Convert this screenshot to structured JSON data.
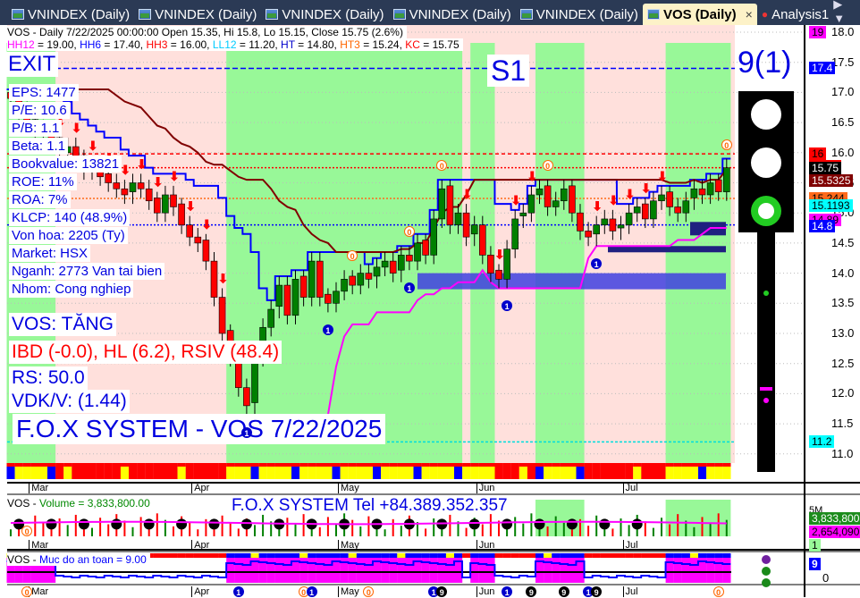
{
  "tabs": [
    {
      "label": "VNINDEX (Daily)"
    },
    {
      "label": "VNINDEX (Daily)"
    },
    {
      "label": "VNINDEX (Daily)"
    },
    {
      "label": "VNINDEX (Daily)"
    },
    {
      "label": "VNINDEX (Daily)"
    },
    {
      "label": "VOS (Daily)",
      "active": true
    },
    {
      "label": "Analysis1"
    }
  ],
  "tab_close": "×",
  "tab_nav": "◀ ▶ ▼",
  "header": {
    "line1": "VOS - Daily 7/22/2025 00:00:00 Open 15.35, Hi 15.8, Lo 15.15, Close 15.75 (2.6%)",
    "hh12": "HH12",
    "hh12v": " = 19.00, ",
    "hh6": "HH6",
    "hh6v": " = 17.40, ",
    "hh3": "HH3",
    "hh3v": " = 16.00, ",
    "ll12": "LL12",
    "ll12v": " = 11.20, ",
    "ht": "HT",
    "htv": "  = 14.80, ",
    "ht3": "HT3",
    "ht3v": "  = 15.24, ",
    "kc": "KC",
    "kcv": " = 15.75"
  },
  "signal_exit": "EXIT",
  "signal_s1": "S1",
  "signal_count": "9(1)",
  "fundamentals": [
    "EPS: 1477",
    "P/E: 10.6",
    "P/B: 1.1",
    "Beta: 1.1",
    "Bookvalue: 13821",
    "ROE: 11%",
    "ROA: 7%",
    "KLCP: 140 (48.9%)",
    "Von hoa: 2205 (Ty)",
    "Market: HSX",
    "Nganh: 2773 Van tai bien",
    "Nhom: Cong nghiep"
  ],
  "status": "VOS: TĂNG",
  "ibd": "IBD (-0.0), HL (6.2), RSIV (48.4)",
  "rs": "RS: 50.0",
  "vdk": "VDK/V:  (1.44)",
  "watermark": "F.O.X SYSTEM - VOS 7/22/2025",
  "price_axis": [
    "18.0",
    "17.5",
    "17.0",
    "16.5",
    "16.0",
    "15.5",
    "15.0",
    "14.5",
    "14.0",
    "13.5",
    "13.0",
    "12.5",
    "12.0",
    "11.5",
    "11.0"
  ],
  "price_badges": [
    {
      "text": "19",
      "bg": "#ff00ff",
      "price": 18.0
    },
    {
      "text": "17.4",
      "bg": "#0000ff",
      "fg": "#fff",
      "price": 17.4
    },
    {
      "text": "16",
      "bg": "#ff0000",
      "price": 15.98
    },
    {
      "text": "15.75",
      "bg": "#ff0000",
      "price": 15.78
    },
    {
      "text": "15.75",
      "bg": "#000",
      "fg": "#fff",
      "price": 15.75
    },
    {
      "text": "15.5325",
      "bg": "#800000",
      "fg": "#fff",
      "price": 15.53
    },
    {
      "text": "15.244",
      "bg": "#ff6a1a",
      "price": 15.24
    },
    {
      "text": "15.1193",
      "bg": "#00ffff",
      "price": 15.12
    },
    {
      "text": "14.89",
      "bg": "#ff00ff",
      "price": 14.89
    },
    {
      "text": "14.8",
      "bg": "#0000ff",
      "fg": "#fff",
      "price": 14.78
    },
    {
      "text": "11.2",
      "bg": "#00ffff",
      "price": 11.2
    }
  ],
  "months": [
    "Mar",
    "Apr",
    "May",
    "Jun",
    "Jul"
  ],
  "volume": {
    "title": "VOS",
    "title2": "Volume = 3,833,800.00",
    "banner": "F.O.X SYSTEM Tel +84.389.352.357",
    "axis_5m": "5M",
    "badge_current": "3,833,800",
    "badge_avg": "2,654,090",
    "badge_one": "1"
  },
  "safety": {
    "title": "VOS",
    "title2": "Muc do an toan = 9.00",
    "badge": "9",
    "axis_zero": "0"
  },
  "colors": {
    "up": "#008000",
    "down": "#ff0000",
    "green_zone": "#98f898",
    "pink_zone": "#ffe0dc",
    "blue_line": "#0000ff",
    "brown_line": "#800000",
    "magenta_line": "#ff00ff"
  },
  "chart_data": {
    "type": "candlestick",
    "symbol": "VOS",
    "interval": "Daily",
    "ylim": [
      10.6,
      18.3
    ],
    "close": [
      16.9,
      16.7,
      16.5,
      16.4,
      16.3,
      16.2,
      16.0,
      16.1,
      15.9,
      15.7,
      15.8,
      15.6,
      15.5,
      15.4,
      15.3,
      15.5,
      15.4,
      15.2,
      15.0,
      15.3,
      15.1,
      14.8,
      14.6,
      14.5,
      14.2,
      13.6,
      13.0,
      12.6,
      12.1,
      11.8,
      12.6,
      13.1,
      13.4,
      13.8,
      13.3,
      13.9,
      13.6,
      14.2,
      13.6,
      13.5,
      13.7,
      13.9,
      13.8,
      14.0,
      13.9,
      14.1,
      14.2,
      14.0,
      14.3,
      14.2,
      14.5,
      14.3,
      14.9,
      15.4,
      14.8,
      15.0,
      14.6,
      14.8,
      14.3,
      14.0,
      13.9,
      14.4,
      14.9,
      15.0,
      15.3,
      15.4,
      15.1,
      15.2,
      15.4,
      15.0,
      14.7,
      14.6,
      14.8,
      14.9,
      14.7,
      14.8,
      15.0,
      15.1,
      14.9,
      15.2,
      15.3,
      15.1,
      15.0,
      15.2,
      15.4,
      15.3,
      15.5,
      15.35,
      15.75
    ],
    "month_start_index": [
      2,
      22,
      40,
      57,
      75
    ],
    "green_zones": [
      [
        0,
        4
      ],
      [
        5,
        5
      ],
      [
        27,
        55
      ],
      [
        57,
        59
      ],
      [
        65,
        70
      ],
      [
        81,
        88
      ]
    ],
    "last": {
      "open": 15.35,
      "high": 15.8,
      "low": 15.15,
      "close": 15.75,
      "change_pct": 2.6
    },
    "levels": {
      "HH6": 17.4,
      "HH3": 16.0,
      "KC": 15.75,
      "HT3": 15.24,
      "HT": 14.8,
      "LL12": 11.2
    },
    "signals": [
      {
        "i": 2,
        "t": "0",
        "p": "vol"
      },
      {
        "i": 29,
        "t": "1",
        "p": "main"
      },
      {
        "i": 42,
        "t": "0",
        "p": "main"
      },
      {
        "i": 49,
        "t": "0",
        "p": "main"
      },
      {
        "i": 53,
        "t": "0",
        "p": "main"
      },
      {
        "i": 66,
        "t": "0",
        "p": "main"
      },
      {
        "i": 88,
        "t": "0",
        "p": "main"
      },
      {
        "i": 61,
        "t": "1",
        "p": "main"
      },
      {
        "i": 72,
        "t": "1",
        "p": "main"
      },
      {
        "i": 49,
        "t": "1",
        "p": "main"
      },
      {
        "i": 39,
        "t": "1",
        "p": "main"
      }
    ],
    "safety_labels": [
      {
        "i": 2,
        "t": "0"
      },
      {
        "i": 28,
        "t": "1"
      },
      {
        "i": 36,
        "t": "0"
      },
      {
        "i": 37,
        "t": "1"
      },
      {
        "i": 44,
        "t": "0"
      },
      {
        "i": 52,
        "t": "1"
      },
      {
        "i": 53,
        "t": "9"
      },
      {
        "i": 61,
        "t": "1"
      },
      {
        "i": 64,
        "t": "9"
      },
      {
        "i": 68,
        "t": "9"
      },
      {
        "i": 71,
        "t": "1"
      },
      {
        "i": 72,
        "t": "9"
      },
      {
        "i": 87,
        "t": "0"
      }
    ]
  }
}
